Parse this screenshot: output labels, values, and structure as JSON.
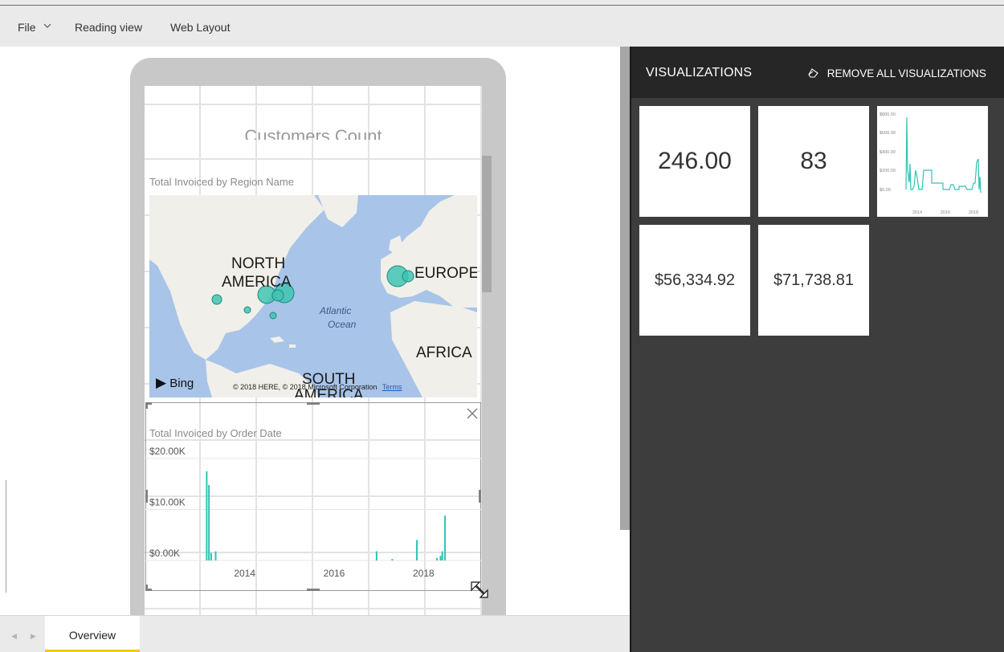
{
  "menu": {
    "file": "File",
    "reading_view": "Reading view",
    "web_layout": "Web Layout"
  },
  "phone_layout": {
    "customers_title": "Customers Count",
    "map": {
      "title": "Total Invoiced by Region Name",
      "labels": {
        "north_america_1": "NORTH",
        "north_america_2": "AMERICA",
        "europe": "EUROPE",
        "atlantic_1": "Atlantic",
        "atlantic_2": "Ocean",
        "africa": "AFRICA",
        "south_america_1": "SOUTH",
        "south_america_2": "AMERICA"
      },
      "bing": "Bing",
      "copyright": "© 2018 HERE, © 2018 Microsoft Corporation",
      "terms": "Terms",
      "bubble_color": "#41c4b3"
    },
    "order_chart": {
      "title": "Total Invoiced by Order Date",
      "y_ticks": [
        "$20.00K",
        "$10.00K",
        "$0.00K"
      ],
      "x_ticks": [
        "2014",
        "2016",
        "2018"
      ]
    }
  },
  "chart_data": {
    "type": "bar",
    "title": "Total Invoiced by Order Date",
    "ylim": [
      0,
      20000
    ],
    "xlim": [
      2013.0,
      2019.0
    ],
    "y_ticks": [
      "$20.00K",
      "$10.00K",
      "$0.00K"
    ],
    "x_ticks": [
      "2014",
      "2016",
      "2018"
    ],
    "x": [
      2013.15,
      2013.2,
      2013.25,
      2013.35,
      2016.95,
      2017.3,
      2017.85,
      2018.3,
      2018.38,
      2018.42,
      2018.48
    ],
    "values": [
      17500,
      14800,
      1500,
      1800,
      1800,
      300,
      4000,
      500,
      900,
      1800,
      8800
    ],
    "color": "#2ec4b6",
    "grid": true
  },
  "tabs": {
    "overview": "Overview"
  },
  "visualizations": {
    "title": "VISUALIZATIONS",
    "remove_all": "REMOVE ALL VISUALIZATIONS",
    "tiles": [
      "246.00",
      "83",
      "$56,334.92",
      "$71,738.81"
    ],
    "mini_chart": {
      "y_ticks": [
        "$800.00",
        "$600.00",
        "$400.00",
        "$200.00",
        "$0.00"
      ],
      "x_ticks": [
        "2014",
        "2016",
        "2018"
      ]
    }
  }
}
